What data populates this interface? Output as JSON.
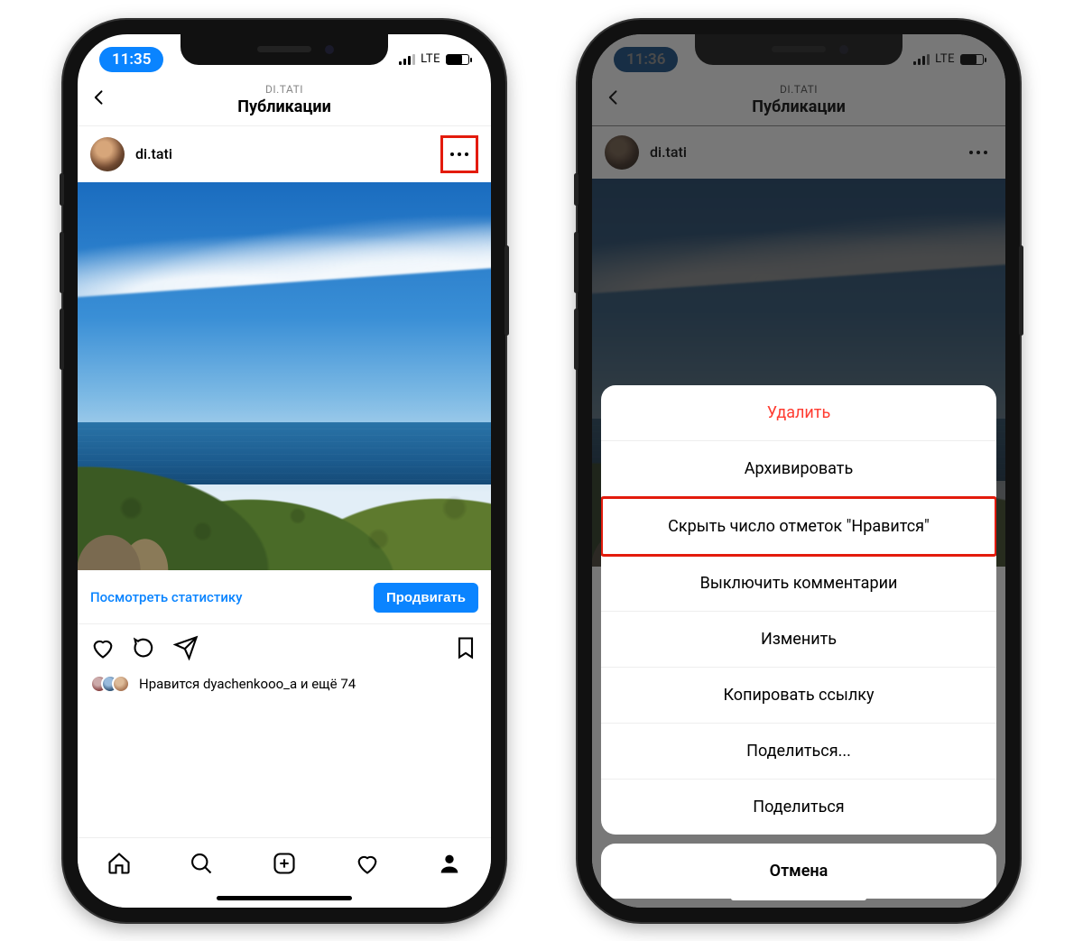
{
  "left": {
    "status": {
      "time": "11:35",
      "network": "LTE"
    },
    "header": {
      "subtitle": "DI.TATI",
      "title": "Публикации"
    },
    "post": {
      "username": "di.tati"
    },
    "promote": {
      "stats": "Посмотреть статистику",
      "button": "Продвигать"
    },
    "likes": {
      "text": "Нравится dyachenkooo_a и ещё 74"
    }
  },
  "right": {
    "status": {
      "time": "11:36",
      "network": "LTE"
    },
    "header": {
      "subtitle": "DI.TATI",
      "title": "Публикации"
    },
    "post": {
      "username": "di.tati"
    },
    "sheet": {
      "items": [
        {
          "label": "Удалить",
          "kind": "destructive"
        },
        {
          "label": "Архивировать",
          "kind": "normal"
        },
        {
          "label": "Скрыть число отметок \"Нравится\"",
          "kind": "highlight"
        },
        {
          "label": "Выключить комментарии",
          "kind": "normal"
        },
        {
          "label": "Изменить",
          "kind": "normal"
        },
        {
          "label": "Копировать ссылку",
          "kind": "normal"
        },
        {
          "label": "Поделиться...",
          "kind": "normal"
        },
        {
          "label": "Поделиться",
          "kind": "normal"
        }
      ],
      "cancel": "Отмена"
    }
  }
}
